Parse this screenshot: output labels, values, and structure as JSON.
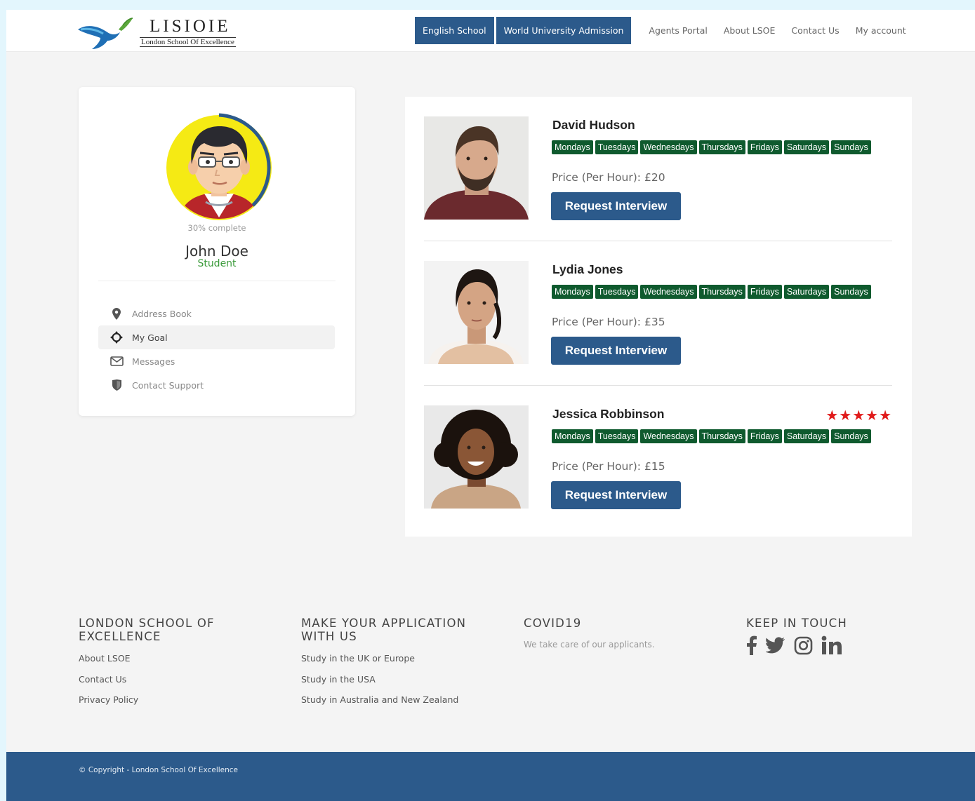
{
  "header": {
    "logo_title": "LISIOIE",
    "logo_subtitle": "London School Of Excellence",
    "nav_buttons": [
      "English School",
      "World University Admission"
    ],
    "nav_links": [
      "Agents Portal",
      "About LSOE",
      "Contact Us",
      "My account"
    ]
  },
  "profile": {
    "progress_text": "30% complete",
    "progress_percent": 30,
    "name": "John Doe",
    "role": "Student",
    "menu": [
      {
        "label": "Address Book",
        "icon": "location-pin-icon",
        "active": false
      },
      {
        "label": "My Goal",
        "icon": "crosshair-icon",
        "active": true
      },
      {
        "label": "Messages",
        "icon": "envelope-icon",
        "active": false
      },
      {
        "label": "Contact Support",
        "icon": "shield-icon",
        "active": false
      }
    ]
  },
  "tutors": [
    {
      "name": "David Hudson",
      "days": [
        "Mondays",
        "Tuesdays",
        "Wednesdays",
        "Thursdays",
        "Fridays",
        "Saturdays",
        "Sundays"
      ],
      "price_label": "Price (Per Hour):",
      "price": "£20",
      "button": "Request Interview",
      "rating": 0
    },
    {
      "name": "Lydia Jones",
      "days": [
        "Mondays",
        "Tuesdays",
        "Wednesdays",
        "Thursdays",
        "Fridays",
        "Saturdays",
        "Sundays"
      ],
      "price_label": "Price (Per Hour):",
      "price": "£35",
      "button": "Request Interview",
      "rating": 0
    },
    {
      "name": "Jessica Robbinson",
      "days": [
        "Mondays",
        "Tuesdays",
        "Wednesdays",
        "Thursdays",
        "Fridays",
        "Saturdays",
        "Sundays"
      ],
      "price_label": "Price (Per Hour):",
      "price": "£15",
      "button": "Request Interview",
      "rating": 5,
      "stars": "★★★★★"
    }
  ],
  "footer": {
    "col1": {
      "heading": "LONDON SCHOOL OF EXCELLENCE",
      "links": [
        "About LSOE",
        "Contact Us",
        "Privacy Policy"
      ]
    },
    "col2": {
      "heading": "MAKE YOUR APPLICATION WITH US",
      "links": [
        "Study in the UK or Europe",
        "Study in the USA",
        "Study in Australia and New Zealand"
      ]
    },
    "col3": {
      "heading": "COVID19",
      "text": "We take care of our applicants."
    },
    "col4": {
      "heading": "KEEP IN TOUCH",
      "socials": [
        "facebook-icon",
        "twitter-icon",
        "instagram-icon",
        "linkedin-icon"
      ]
    },
    "copyright": "© Copyright - London School Of Excellence"
  },
  "colors": {
    "primary": "#2c5a8b",
    "tag_green": "#0f5a2e",
    "role_green": "#3a9a3a",
    "star_red": "#e01b1b",
    "page_bg": "#f4f4f4",
    "outer_bg": "#e3f6fd"
  }
}
